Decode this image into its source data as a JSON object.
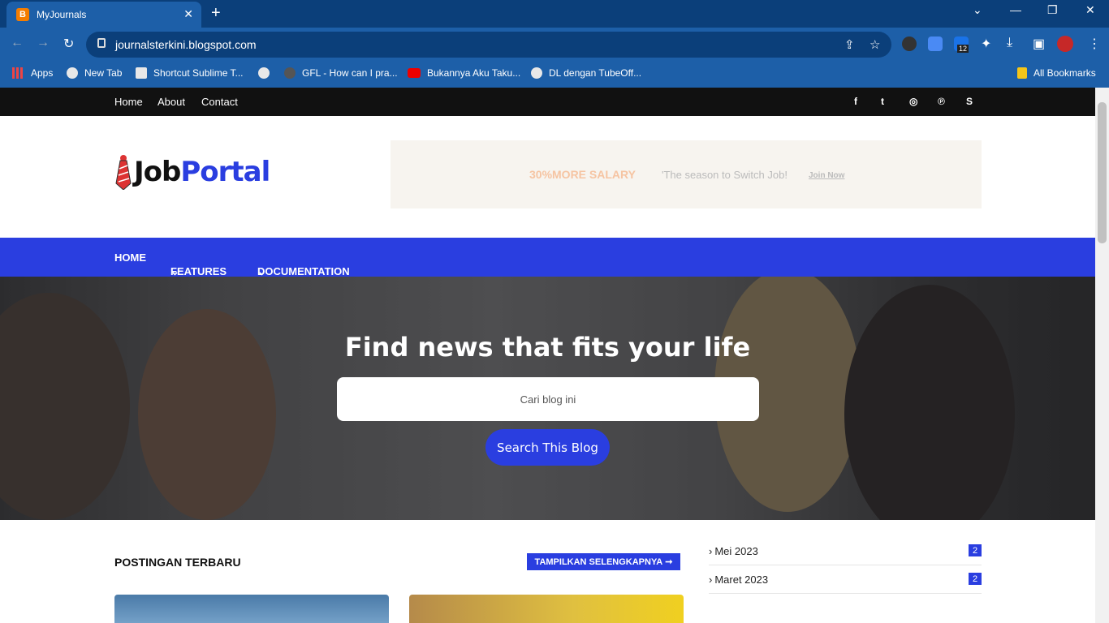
{
  "browser": {
    "tab_title": "MyJournals",
    "tab_favicon": "blogger-icon",
    "url": "journalsterkini.blogspot.com",
    "extension_badge": "12",
    "bookmarks": [
      {
        "label": "Apps",
        "icon": "apps-grid-icon"
      },
      {
        "label": "New Tab",
        "icon": "globe-icon"
      },
      {
        "label": "Shortcut Sublime T...",
        "icon": "page-icon"
      },
      {
        "label": "",
        "icon": "globe-icon"
      },
      {
        "label": "GFL - How can I pra...",
        "icon": "gfl-icon"
      },
      {
        "label": "Bukannya Aku Taku...",
        "icon": "youtube-icon"
      },
      {
        "label": "DL dengan TubeOff...",
        "icon": "globe-icon"
      }
    ],
    "all_bookmarks": "All Bookmarks"
  },
  "site": {
    "topnav": [
      "Home",
      "About",
      "Contact"
    ],
    "social_icons": [
      "facebook-icon",
      "twitter-icon",
      "instagram-icon",
      "pinterest-icon",
      "skype-icon"
    ],
    "logo_job": "Job",
    "logo_portal": "Portal",
    "ad": {
      "headline": "30%MORE SALARY",
      "text": "'The season to Switch Job!",
      "cta": "Join Now"
    },
    "mainnav": [
      "HOME",
      "FEATURES",
      "DOCUMENTATION"
    ],
    "hero": {
      "title": "Find news that fits your life",
      "search_placeholder": "Cari blog ini",
      "search_button": "Search This Blog"
    },
    "posts": {
      "title": "POSTINGAN TERBARU",
      "more_button": "TAMPILKAN SELENGKAPNYA"
    },
    "archive": [
      {
        "label": "Mei 2023",
        "count": "2"
      },
      {
        "label": "Maret 2023",
        "count": "2"
      }
    ]
  },
  "colors": {
    "accent": "#2a3ee0",
    "browser_frame": "#0b3f7a",
    "browser_toolbar": "#1d5fa8"
  }
}
